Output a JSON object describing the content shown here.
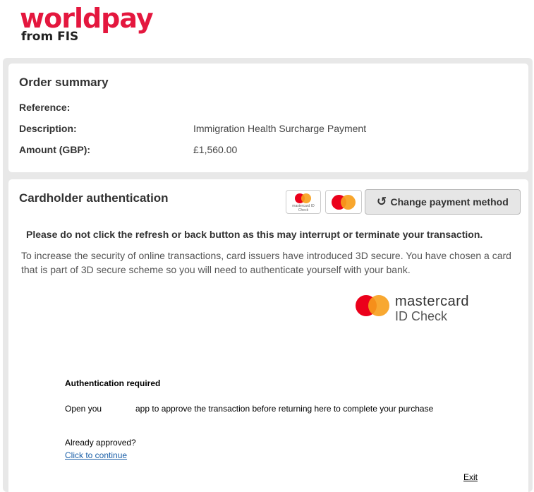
{
  "brand": {
    "name": "worldpay",
    "sub": "from FIS",
    "color": "#e4173e"
  },
  "order_summary": {
    "title": "Order summary",
    "rows": [
      {
        "label": "Reference:",
        "value": ""
      },
      {
        "label": "Description:",
        "value": "Immigration Health Surcharge Payment"
      },
      {
        "label": "Amount (GBP):",
        "value": "£1,560.00"
      }
    ]
  },
  "auth": {
    "title": "Cardholder authentication",
    "change_label": "Change payment method",
    "thumb_caption": "mastercard ID Check",
    "warning": "Please do not click the refresh or back button as this may interrupt or terminate your transaction.",
    "info": "To increase the security of online transactions, card issuers have introduced 3D secure. You have chosen a card that is part of 3D secure scheme so you will need to authenticate yourself with your bank.",
    "idcheck_line1": "mastercard",
    "idcheck_line2": "ID Check"
  },
  "acs": {
    "heading": "Authentication required",
    "open_text_a": "Open you",
    "open_text_b": "app to approve the transaction before returning here to complete your purchase",
    "already": "Already approved?",
    "continue_link": "Click to continue",
    "exit_link": "Exit"
  },
  "colors": {
    "mc_red": "#eb001b",
    "mc_orange": "#f79e1b",
    "panel_bg": "#e8e8e8"
  }
}
